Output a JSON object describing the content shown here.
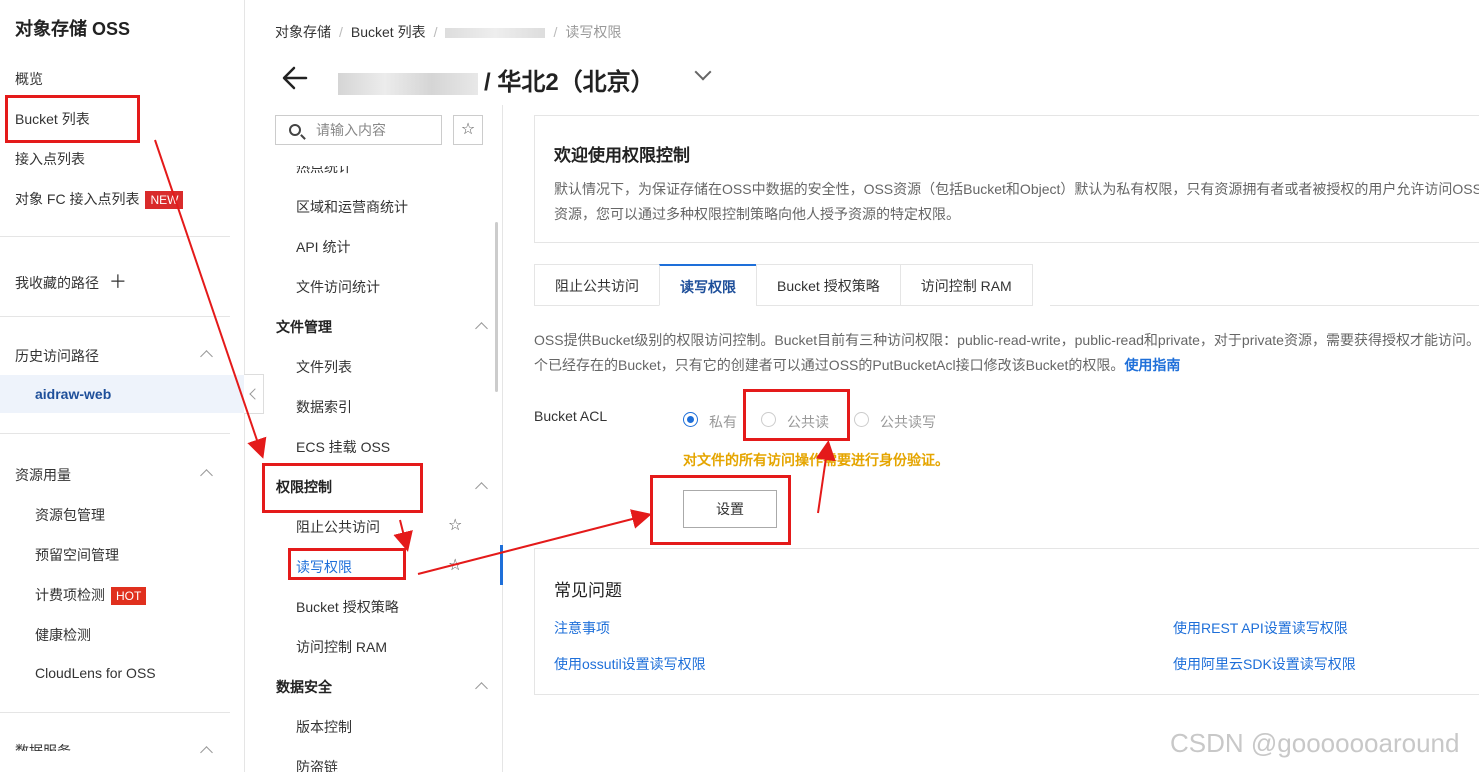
{
  "sidebar": {
    "brand": "对象存储 OSS",
    "items": {
      "overview": "概览",
      "bucket_list": "Bucket 列表",
      "access_points": "接入点列表",
      "fc_access_points": "对象 FC 接入点列表",
      "fc_badge": "NEW",
      "favorites": "我收藏的路径",
      "favorites_add": "＋",
      "history": "历史访问路径",
      "history_item": "aidraw-web",
      "resource_usage": "资源用量",
      "resource_pack": "资源包管理",
      "reserved_space": "预留空间管理",
      "billing_check": "计费项检测",
      "billing_badge": "HOT",
      "health_check": "健康检测",
      "cloudlens": "CloudLens for OSS",
      "data_service": "数据服务"
    }
  },
  "breadcrumb": {
    "b1": "对象存储",
    "b2": "Bucket 列表",
    "b4": "读写权限"
  },
  "title": {
    "region": "/ 华北2（北京）"
  },
  "nav2": {
    "search_placeholder": "请输入内容",
    "star": "☆",
    "cut_top": "热点统计",
    "region_stats": "区域和运营商统计",
    "api_stats": "API 统计",
    "file_access_stats": "文件访问统计",
    "file_mgmt": "文件管理",
    "file_list": "文件列表",
    "data_index": "数据索引",
    "ecs_mount": "ECS 挂载 OSS",
    "access_control": "权限控制",
    "block_public": "阻止公共访问",
    "rw_perm": "读写权限",
    "bucket_policy": "Bucket 授权策略",
    "ram": "访问控制 RAM",
    "data_security": "数据安全",
    "versioning": "版本控制",
    "hotlink": "防盗链"
  },
  "welcome": {
    "heading": "欢迎使用权限控制",
    "text": "默认情况下，为保证存储在OSS中数据的安全性，OSS资源（包括Bucket和Object）默认为私有权限，只有资源拥有者或者被授权的用户允许访问OSS资源，您可以通过多种权限控制策略向他人授予资源的特定权限。"
  },
  "tabs": [
    "阻止公共访问",
    "读写权限",
    "Bucket 授权策略",
    "访问控制 RAM"
  ],
  "desc": {
    "text": "OSS提供Bucket级别的权限访问控制。Bucket目前有三种访问权限：public-read-write，public-read和private，对于private资源，需要获得授权才能访问。一个已经存在的Bucket，只有它的创建者可以通过OSS的PutBucketAcl接口修改该Bucket的权限。",
    "link": "使用指南"
  },
  "acl": {
    "label": "Bucket ACL",
    "options": [
      "私有",
      "公共读",
      "公共读写"
    ],
    "selected": "私有",
    "warning": "对文件的所有访问操作需要进行身份验证。",
    "button": "设置"
  },
  "faq": {
    "heading": "常见问题",
    "links": [
      "注意事项",
      "使用REST API设置读写权限",
      "使用ossutil设置读写权限",
      "使用阿里云SDK设置读写权限"
    ]
  },
  "watermark": "CSDN @gooooooaround",
  "colors": {
    "accent": "#1e6fd9",
    "annotation": "#e41a1a",
    "warning": "#e5a500"
  }
}
